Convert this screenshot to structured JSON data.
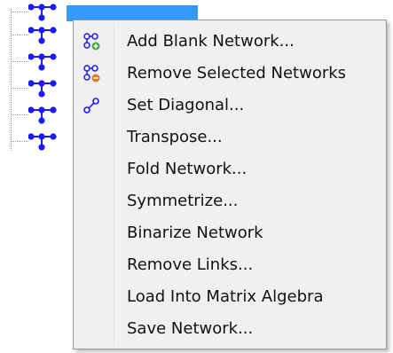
{
  "tree": {
    "node_count": 6
  },
  "menu": {
    "items": [
      {
        "label": "Add Blank Network...",
        "icon": "add-network-icon"
      },
      {
        "label": "Remove Selected Networks",
        "icon": "remove-network-icon"
      },
      {
        "label": "Set Diagonal...",
        "icon": "set-diagonal-icon"
      },
      {
        "label": "Transpose...",
        "icon": ""
      },
      {
        "label": "Fold Network...",
        "icon": ""
      },
      {
        "label": "Symmetrize...",
        "icon": ""
      },
      {
        "label": "Binarize Network",
        "icon": ""
      },
      {
        "label": "Remove Links...",
        "icon": ""
      },
      {
        "label": "Load Into Matrix Algebra",
        "icon": ""
      },
      {
        "label": "Save Network...",
        "icon": ""
      }
    ]
  },
  "colors": {
    "selection": "#3399ff",
    "network_icon": "#1a1aff",
    "add_badge": "#3fae3f",
    "remove_badge": "#e07a2a"
  }
}
